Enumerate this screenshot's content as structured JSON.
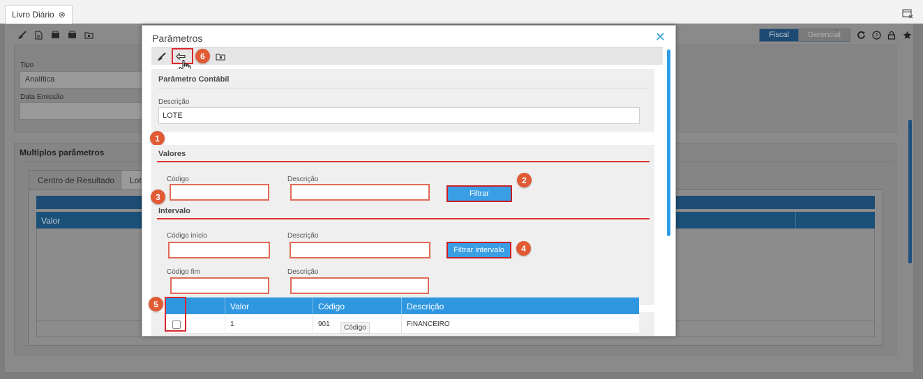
{
  "app": {
    "tab_title": "Livro Diário",
    "modes": {
      "fiscal": "Fiscal",
      "gerencial": "Gerencial"
    }
  },
  "background": {
    "tipo_label": "Tipo",
    "tipo_value": "Analítica",
    "data_emissao_label": "Data Emissão",
    "multi_title": "Multiplos parâmetros",
    "subtab_centro": "Centro de Resultado",
    "subtab_lote": "Lote",
    "grid_col_valor": "Valor"
  },
  "modal": {
    "title": "Parâmetros",
    "param_section_title": "Parâmetro Contábil",
    "descricao_label": "Descrição",
    "descricao_value": "LOTE",
    "valores": {
      "title": "Valores",
      "codigo_label": "Código",
      "descricao_label": "Descrição",
      "filter_button": "Filtrar"
    },
    "intervalo": {
      "title": "Intervalo",
      "codigo_inicio_label": "Código início",
      "descricao_label_1": "Descrição",
      "codigo_fim_label": "Código fim",
      "descricao_label_2": "Descrição",
      "filter_button": "Filtrar intervalo"
    },
    "table": {
      "headers": {
        "valor": "Valor",
        "codigo": "Código",
        "descricao": "Descrição"
      },
      "rows": [
        {
          "valor": "1",
          "codigo": "901",
          "descricao": "FINANCEIRO"
        }
      ]
    },
    "tooltip": "Código"
  },
  "badges": [
    "1",
    "2",
    "3",
    "4",
    "5",
    "6"
  ],
  "colors": {
    "accent_blue": "#2f97e0",
    "annotation_red": "#d9272e",
    "badge_orange": "#e05a34"
  }
}
